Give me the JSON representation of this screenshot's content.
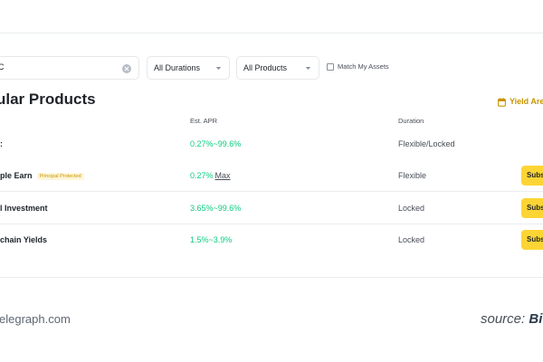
{
  "filters": {
    "search_value": "C",
    "duration_select": "All Durations",
    "product_select": "All Products",
    "match_assets": "Match My Assets"
  },
  "section": {
    "title": "ular Products",
    "yield_link": "Yield Are"
  },
  "table": {
    "columns": [
      "Est. APR",
      "Duration"
    ],
    "rows": [
      {
        "name": ":",
        "badge": "",
        "apr": "0.27%~99.6%",
        "apr_suffix": "",
        "duration": "Flexible/Locked",
        "action": ""
      },
      {
        "name": "ple Earn",
        "badge": "Principal Protected",
        "apr": "0.27%",
        "apr_suffix": "Max",
        "duration": "Flexible",
        "action": "Subs"
      },
      {
        "name": "l Investment",
        "badge": "",
        "apr": "3.65%~99.6%",
        "apr_suffix": "",
        "duration": "Locked",
        "action": "Subs"
      },
      {
        "name": "chain Yields",
        "badge": "",
        "apr": "1.5%~3.9%",
        "apr_suffix": "",
        "duration": "Locked",
        "action": "Subs"
      }
    ]
  },
  "footer": {
    "left": "elegraph.com",
    "right_prefix": "source: ",
    "right_brand": "Bi"
  },
  "colors": {
    "accent_yellow": "#fcd535",
    "gold_text": "#c99400",
    "positive_green": "#0ecb81"
  },
  "icons": {
    "clear": "clear-icon",
    "chevron": "chevron-down-icon",
    "checkbox": "checkbox-icon",
    "yield": "calendar-icon"
  }
}
